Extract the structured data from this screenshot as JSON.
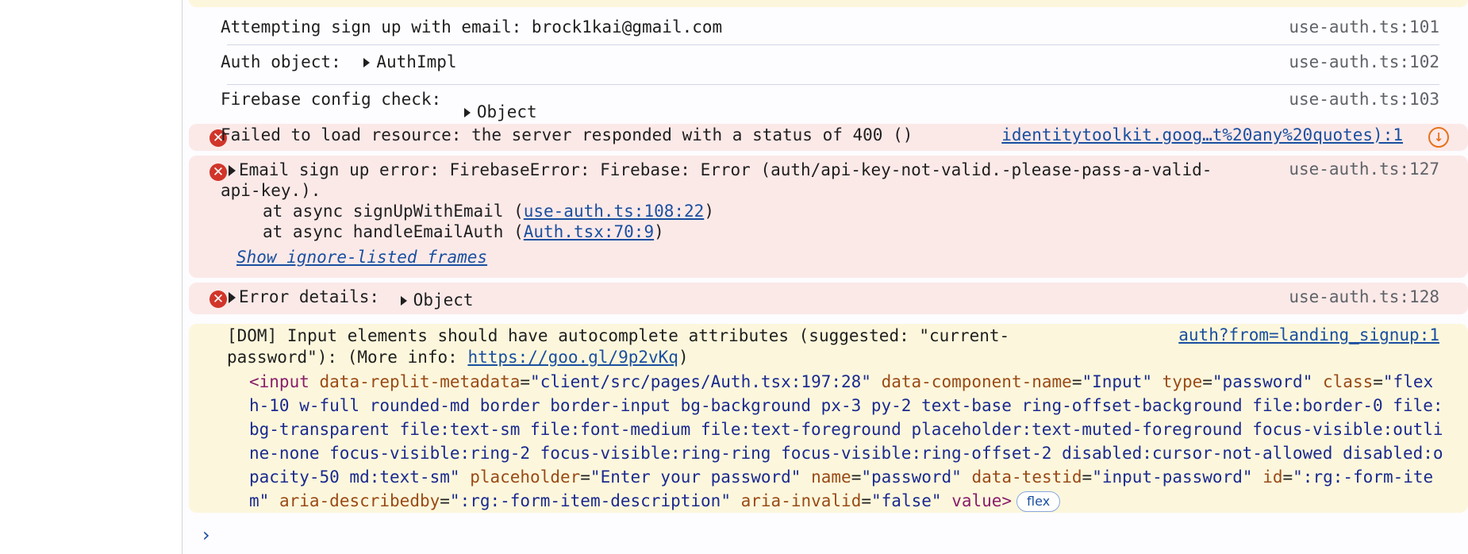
{
  "log1": {
    "message": "Attempting sign up with email: brock1kai@gmail.com",
    "source": "use-auth.ts:101"
  },
  "log2": {
    "message": "Auth object:",
    "object": "AuthImpl",
    "source": "use-auth.ts:102"
  },
  "log3": {
    "message": "Firebase config check:",
    "object": "Object",
    "source": "use-auth.ts:103"
  },
  "error1": {
    "message": "Failed to load resource: the server responded with a status of 400 ()",
    "source": "identitytoolkit.goog…t%20any%20quotes):1"
  },
  "error2": {
    "message_line1": "Email sign up error: FirebaseError: Firebase: Error (auth/api-key-not-valid.-please-pass-a-valid-",
    "message_line2": "api-key.).",
    "stack1_prefix": "at async signUpWithEmail (",
    "stack1_link": "use-auth.ts:108:22",
    "stack2_prefix": "at async handleEmailAuth (",
    "stack2_link": "Auth.tsx:70:9",
    "stack_suffix": ")",
    "show_frames": "Show ignore-listed frames",
    "source": "use-auth.ts:127"
  },
  "error3": {
    "message": "Error details:",
    "object": "Object",
    "source": "use-auth.ts:128"
  },
  "warning": {
    "line1": "[DOM] Input elements should have autocomplete attributes (suggested: \"current-",
    "line2_prefix": "password\"): (More info: ",
    "line2_link": "https://goo.gl/9p2vKq",
    "line2_suffix": ")",
    "source": "auth?from=landing_signup:1",
    "tag_open": "<input",
    "attrs": [
      {
        "name": "data-replit-metadata",
        "value": "client/src/pages/Auth.tsx:197:28"
      },
      {
        "name": "data-component-name",
        "value": "Input"
      },
      {
        "name": "type",
        "value": "password"
      },
      {
        "name": "class",
        "value": "flex h-10 w-full rounded-md border border-input bg-background px-3 py-2 text-base ring-offset-background file:border-0 file:bg-transparent file:text-sm file:font-medium file:text-foreground placeholder:text-muted-foreground focus-visible:outline-none focus-visible:ring-2 focus-visible:ring-ring focus-visible:ring-offset-2 disabled:cursor-not-allowed disabled:opacity-50 md:text-sm"
      },
      {
        "name": "placeholder",
        "value": "Enter your password"
      },
      {
        "name": "name",
        "value": "password"
      },
      {
        "name": "data-testid",
        "value": "input-password"
      },
      {
        "name": "id",
        "value": ":rg:-form-item"
      },
      {
        "name": "aria-describedby",
        "value": ":rg:-form-item-description"
      },
      {
        "name": "aria-invalid",
        "value": "false"
      }
    ],
    "tail": "value>",
    "badge": "flex"
  },
  "prompt": {
    "symbol": "›",
    "icon": "chevron-right-icon"
  },
  "colors": {
    "error_bg": "#fbe9e8",
    "warning_bg": "#fcf7dc",
    "error_icon": "#d1352a",
    "link": "#1a4fa0"
  }
}
